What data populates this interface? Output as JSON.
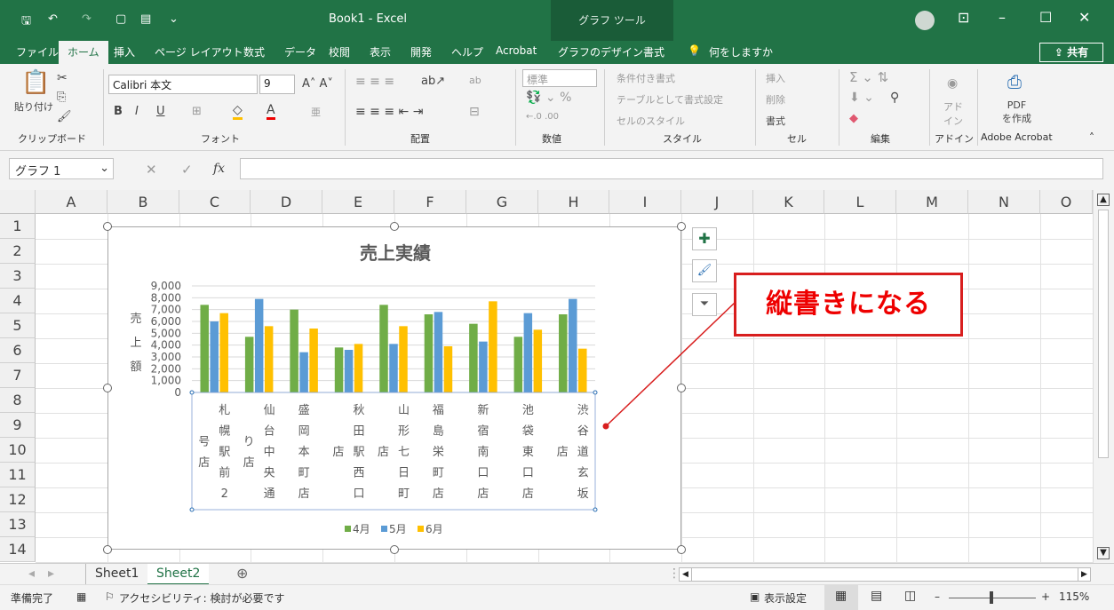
{
  "titlebar": {
    "title": "Book1  -  Excel",
    "chart_tools": "グラフ ツール"
  },
  "tabs": [
    "ファイル",
    "ホーム",
    "挿入",
    "ページ レイアウト",
    "数式",
    "データ",
    "校閲",
    "表示",
    "開発",
    "ヘルプ",
    "Acrobat",
    "グラフのデザイン",
    "書式"
  ],
  "tell_me": "何をしますか",
  "share": "共有",
  "ribbon": {
    "paste": "貼り付け",
    "font_name": "Calibri 本文",
    "font_size": "9",
    "number_format": "標準",
    "conditional": "条件付き書式",
    "as_table": "テーブルとして書式設定",
    "cell_style": "セルのスタイル",
    "insert": "挿入",
    "delete": "削除",
    "format": "書式",
    "addin": "アド\nイン",
    "pdf": "PDF\nを作成",
    "groups": [
      "クリップボード",
      "フォント",
      "配置",
      "数値",
      "スタイル",
      "セル",
      "編集",
      "アドイン",
      "Adobe Acrobat"
    ]
  },
  "formula_bar": {
    "name_box": "グラフ 1",
    "fx": "fx",
    "value": ""
  },
  "columns": [
    "A",
    "B",
    "C",
    "D",
    "E",
    "F",
    "G",
    "H",
    "I",
    "J",
    "K",
    "L",
    "M",
    "N",
    "O"
  ],
  "rows": [
    "1",
    "2",
    "3",
    "4",
    "5",
    "6",
    "7",
    "8",
    "9",
    "10",
    "11",
    "12",
    "13",
    "14"
  ],
  "callout": {
    "text": "縦書きになる",
    "color": "#d81e1e"
  },
  "sheets": [
    "Sheet1",
    "Sheet2"
  ],
  "status": {
    "ready": "準備完了",
    "accessibility": "アクセシビリティ: 検討が必要です",
    "display_settings": "表示設定",
    "zoom": "115%"
  },
  "chart_data": {
    "type": "bar",
    "title": "売上実績",
    "ylabel": "売上額",
    "ylim": [
      0,
      9000
    ],
    "yticks": [
      "0",
      "1,000",
      "2,000",
      "3,000",
      "4,000",
      "5,000",
      "6,000",
      "7,000",
      "8,000",
      "9,000"
    ],
    "categories": [
      "札幌駅前2号店",
      "仙台中央通り店",
      "盛岡本町店",
      "秋田駅西口店",
      "山形七日町店",
      "福島栄町店",
      "新宿南口店",
      "池袋東口店",
      "渋谷道玄坂店"
    ],
    "series": [
      {
        "name": "4月",
        "color": "#70ad47",
        "values": [
          7400,
          4700,
          7000,
          3800,
          7400,
          6600,
          5800,
          4700,
          6600
        ]
      },
      {
        "name": "5月",
        "color": "#5b9bd5",
        "values": [
          6000,
          7900,
          3400,
          3600,
          4100,
          6800,
          4300,
          6700,
          7900
        ]
      },
      {
        "name": "6月",
        "color": "#ffc000",
        "values": [
          6700,
          5600,
          5400,
          4100,
          5600,
          3900,
          7700,
          5300,
          3700
        ]
      }
    ]
  }
}
